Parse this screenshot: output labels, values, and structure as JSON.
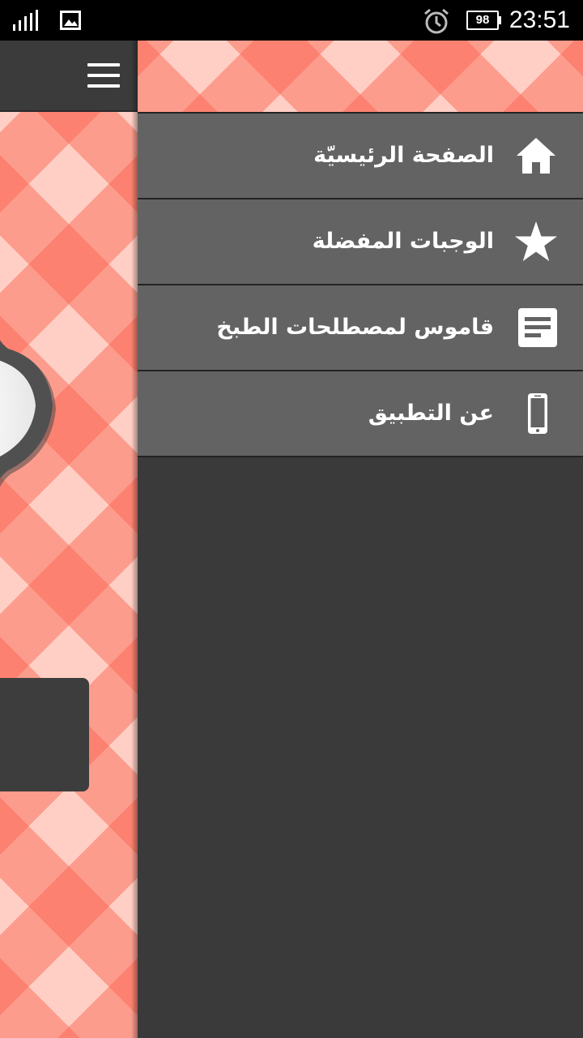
{
  "status_bar": {
    "battery": "98",
    "time": "23:51",
    "icons": [
      "signal-icon",
      "image-notification-icon",
      "alarm-icon",
      "battery-icon"
    ]
  },
  "main": {
    "toolbar_icon": "menu-icon"
  },
  "drawer": {
    "items": [
      {
        "label": "الصفحة الرئيسيّة",
        "icon": "home-icon"
      },
      {
        "label": "الوجبات المفضلة",
        "icon": "star-icon"
      },
      {
        "label": "قاموس لمصطلحات الطبخ",
        "icon": "article-icon"
      },
      {
        "label": "عن التطبيق",
        "icon": "phone-icon"
      }
    ]
  },
  "colors": {
    "toolbar": "#3b3b3b",
    "drawer_item": "#636363",
    "drawer_bg": "#3a3a3a",
    "gingham_light": "#ffcfc5",
    "gingham_dark": "#fa6450"
  }
}
